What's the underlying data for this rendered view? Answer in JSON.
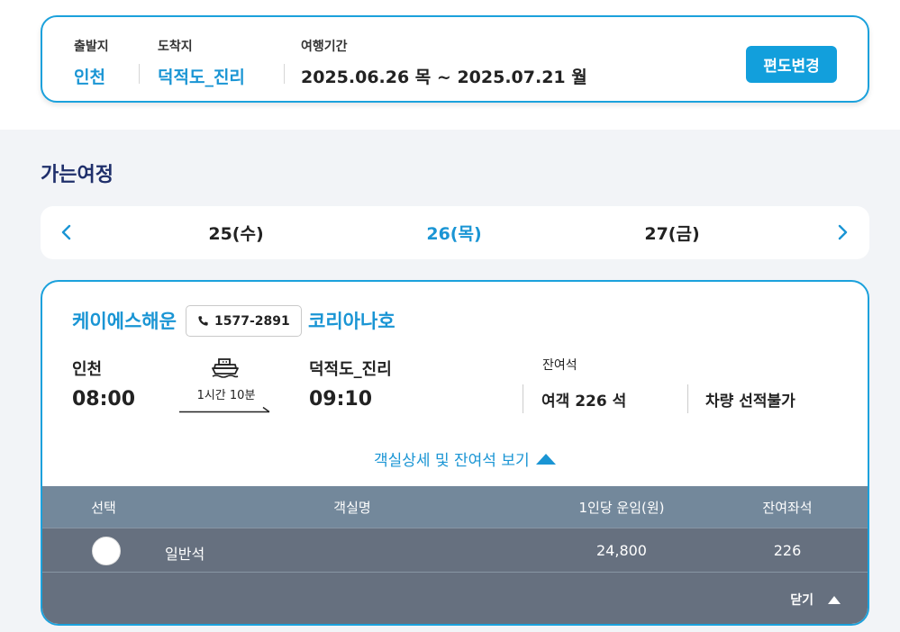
{
  "summary": {
    "departure_label": "출발지",
    "departure_value": "인천",
    "arrival_label": "도착지",
    "arrival_value": "덕적도_진리",
    "period_label": "여행기간",
    "period_value": "2025.06.26 목 ~ 2025.07.21 월",
    "change_button": "편도변경"
  },
  "section_title": "가는여정",
  "dates": {
    "prev": "25(수)",
    "current": "26(목)",
    "next": "27(금)"
  },
  "trip": {
    "operator": "케이에스해운",
    "phone": "1577-2891",
    "ship": "코리아나호",
    "origin": "인천",
    "depart_time": "08:00",
    "duration": "1시간 10분",
    "destination": "덕적도_진리",
    "arrive_time": "09:10",
    "seat_label": "잔여석",
    "passenger_seats": "여객 226 석",
    "vehicle_seats": "차량 선적불가",
    "toggle_label": "객실상세 및 잔여석 보기"
  },
  "table": {
    "headers": [
      "선택",
      "객실명",
      "1인당 운임(원)",
      "잔여좌석"
    ],
    "rows": [
      {
        "name": "일반석",
        "fare": "24,800",
        "seats": "226"
      }
    ],
    "close_label": "닫기"
  },
  "colors": {
    "accent": "#1a95d4",
    "button": "#129fdc",
    "title": "#1f2f6b",
    "table_head": "#73889b",
    "table_body": "#66707f"
  }
}
